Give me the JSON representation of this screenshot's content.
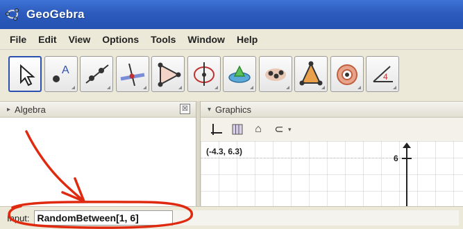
{
  "window": {
    "title": "GeoGebra"
  },
  "menu": {
    "items": [
      "File",
      "Edit",
      "View",
      "Options",
      "Tools",
      "Window",
      "Help"
    ]
  },
  "toolbar": {
    "tools": [
      {
        "icon": "move-arrow-icon"
      },
      {
        "icon": "point-icon"
      },
      {
        "icon": "line-through-two-points-icon"
      },
      {
        "icon": "perpendicular-line-icon"
      },
      {
        "icon": "polygon-icon"
      },
      {
        "icon": "circle-with-center-icon"
      },
      {
        "icon": "ellipse-icon"
      },
      {
        "icon": "reflect-about-line-icon"
      },
      {
        "icon": "angle-icon"
      },
      {
        "icon": "slider-icon"
      },
      {
        "icon": "text-icon"
      }
    ]
  },
  "algebra": {
    "title": "Algebra"
  },
  "graphics": {
    "title": "Graphics",
    "coordinates": "(-4.3, 6.3)",
    "tick_label": "6"
  },
  "inputbar": {
    "label": "Input:",
    "value": "RandomBetween[1, 6]"
  },
  "colors": {
    "title_bar": "#2c5bbd",
    "annotation": "#e02a10"
  }
}
